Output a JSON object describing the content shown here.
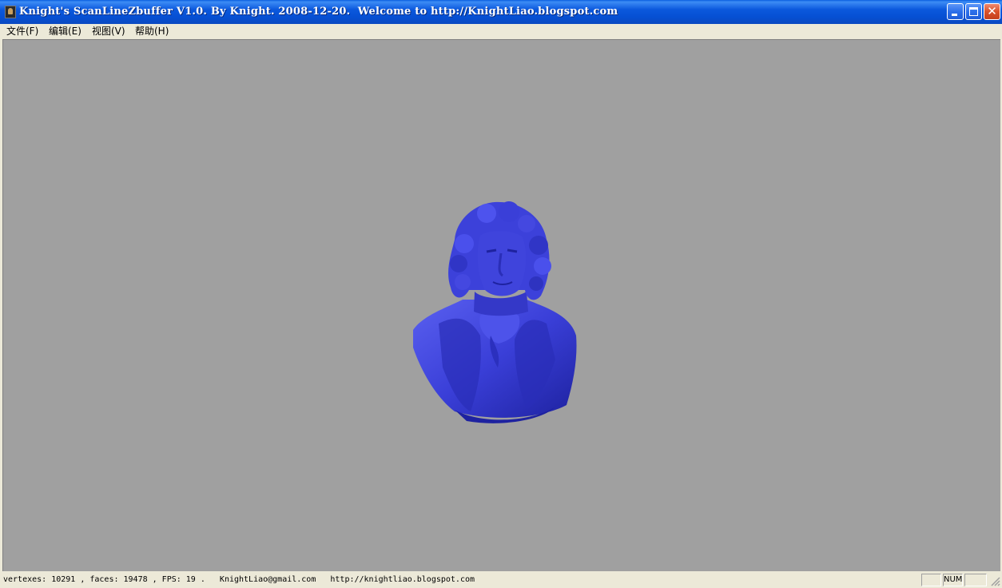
{
  "window": {
    "title": "Knight's ScanLineZbuffer V1.0. By Knight. 2008-12-20.  Welcome to http://KnightLiao.blogspot.com"
  },
  "menu": {
    "items": [
      {
        "label": "文件(F)"
      },
      {
        "label": "编辑(E)"
      },
      {
        "label": "视图(V)"
      },
      {
        "label": "帮助(H)"
      }
    ]
  },
  "viewport": {
    "background": "#A0A0A0",
    "model_color": "#3A3FD8",
    "model": "bust-sculpture"
  },
  "status": {
    "text": "vertexes: 10291 , faces: 19478 , FPS: 19 .   KnightLiao@gmail.com   http://knightliao.blogspot.com",
    "panes": [
      "",
      "NUM",
      ""
    ]
  }
}
